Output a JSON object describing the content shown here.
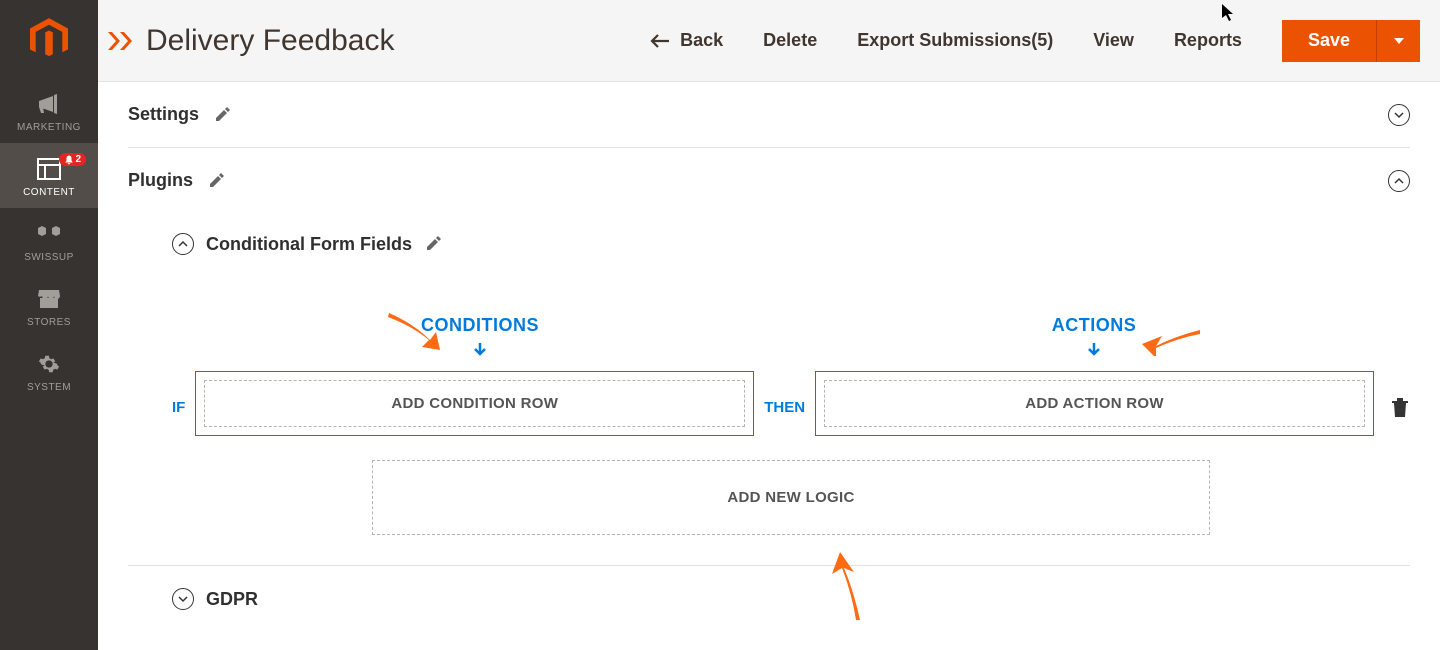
{
  "sidebar": {
    "items": [
      {
        "id": "marketing",
        "label": "MARKETING"
      },
      {
        "id": "content",
        "label": "CONTENT"
      },
      {
        "id": "swissup",
        "label": "SWISSUP"
      },
      {
        "id": "stores",
        "label": "STORES"
      },
      {
        "id": "system",
        "label": "SYSTEM"
      }
    ],
    "notification_count": "2"
  },
  "header": {
    "title": "Delivery Feedback",
    "back": "Back",
    "delete": "Delete",
    "export": "Export Submissions(5)",
    "view": "View",
    "reports": "Reports",
    "save": "Save"
  },
  "sections": {
    "settings": "Settings",
    "plugins": "Plugins",
    "conditional": "Conditional Form Fields",
    "gdpr": "GDPR"
  },
  "conditional": {
    "conditions_label": "CONDITIONS",
    "actions_label": "ACTIONS",
    "if_label": "IF",
    "then_label": "THEN",
    "add_condition": "ADD CONDITION ROW",
    "add_action": "ADD ACTION ROW",
    "add_logic": "ADD NEW LOGIC"
  },
  "colors": {
    "accent_blue": "#007bdb",
    "accent_orange": "#eb5202",
    "annotation_orange": "#ff6a13"
  }
}
